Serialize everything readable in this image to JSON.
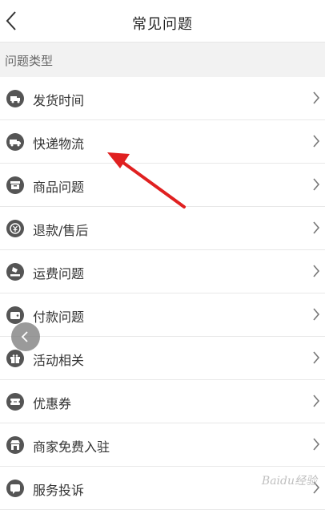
{
  "header": {
    "title": "常见问题"
  },
  "section": {
    "label": "问题类型"
  },
  "items": [
    {
      "label": "发货时间",
      "icon": "shipping-truck-icon"
    },
    {
      "label": "快递物流",
      "icon": "delivery-van-icon"
    },
    {
      "label": "商品问题",
      "icon": "product-box-icon"
    },
    {
      "label": "退款/售后",
      "icon": "refund-yen-icon"
    },
    {
      "label": "运费问题",
      "icon": "freight-hand-icon"
    },
    {
      "label": "付款问题",
      "icon": "wallet-icon"
    },
    {
      "label": "活动相关",
      "icon": "gift-icon"
    },
    {
      "label": "优惠券",
      "icon": "coupon-icon"
    },
    {
      "label": "商家免费入驻",
      "icon": "store-icon"
    },
    {
      "label": "服务投诉",
      "icon": "complaint-icon"
    }
  ],
  "watermark": {
    "text": "Baidu经验"
  },
  "colors": {
    "arrow": "#e02020",
    "icon": "#555555",
    "divider": "#e8e8e8"
  }
}
